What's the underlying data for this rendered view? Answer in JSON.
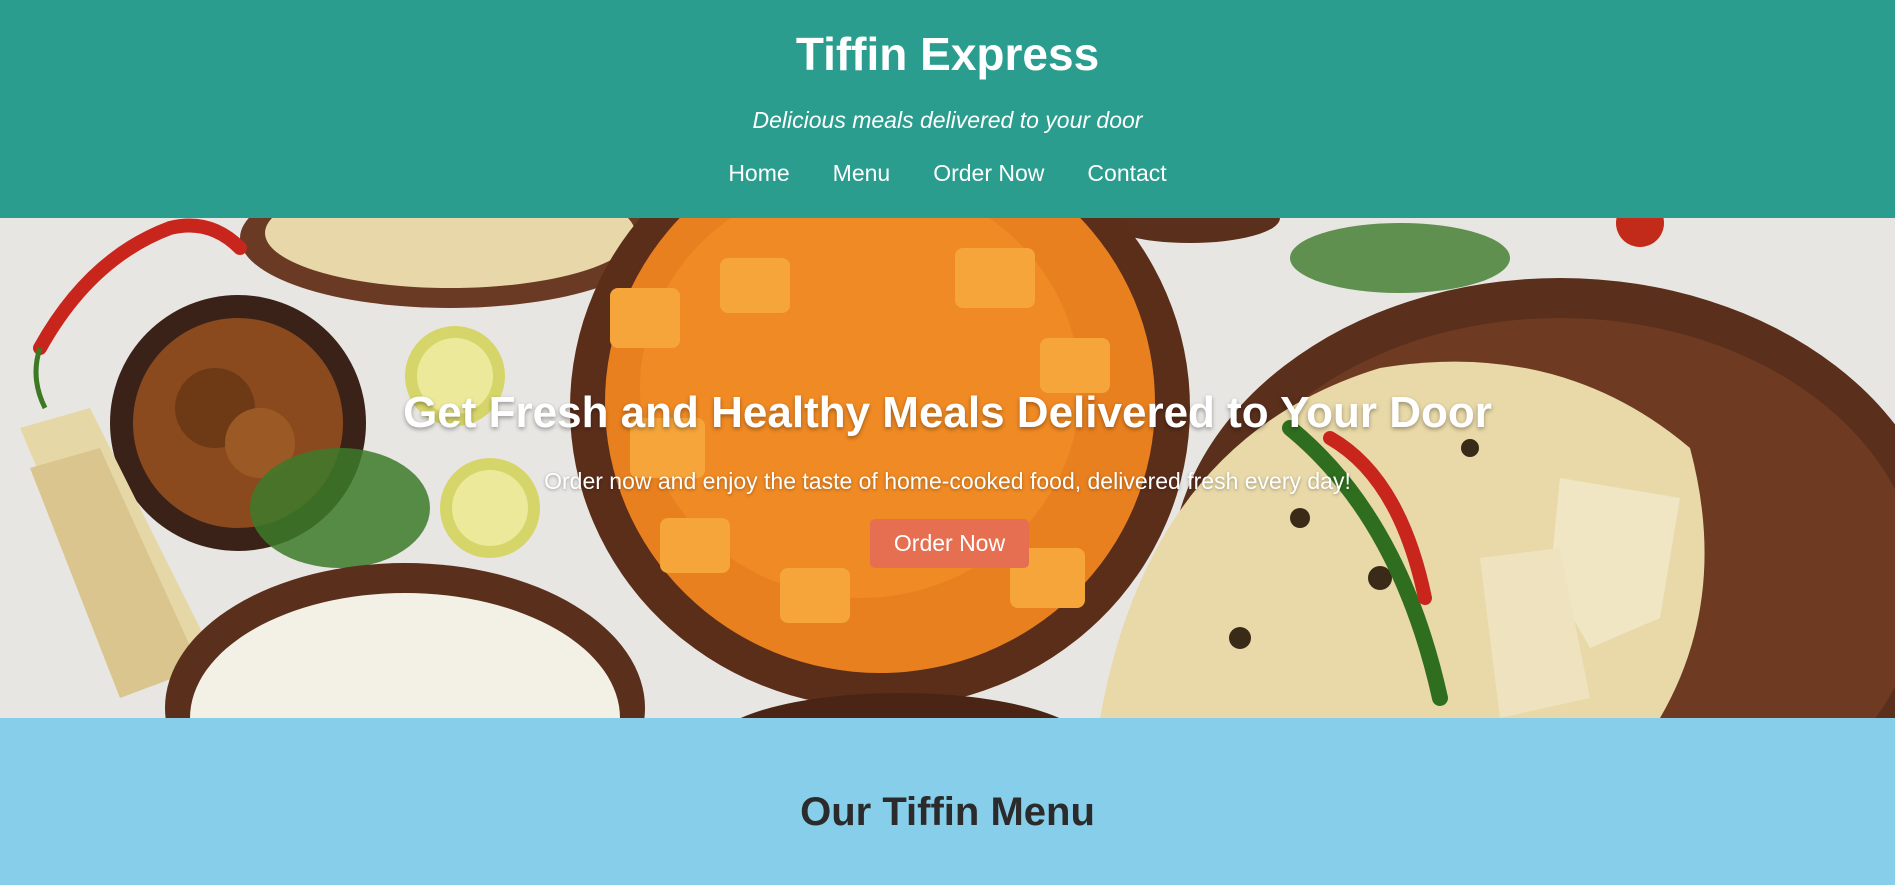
{
  "header": {
    "title": "Tiffin Express",
    "tagline": "Delicious meals delivered to your door",
    "nav": [
      "Home",
      "Menu",
      "Order Now",
      "Contact"
    ]
  },
  "hero": {
    "heading": "Get Fresh and Healthy Meals Delivered to Your Door",
    "subheading": "Order now and enjoy the taste of home-cooked food, delivered fresh every day!",
    "cta_label": "Order Now",
    "background_image": "food-spread-image"
  },
  "menu_section": {
    "title": "Our Tiffin Menu"
  },
  "colors": {
    "header_bg": "#2a9d8f",
    "cta_bg": "#e76f51",
    "section_bg": "#87ceeb",
    "heading_text": "#2b2b2b"
  }
}
